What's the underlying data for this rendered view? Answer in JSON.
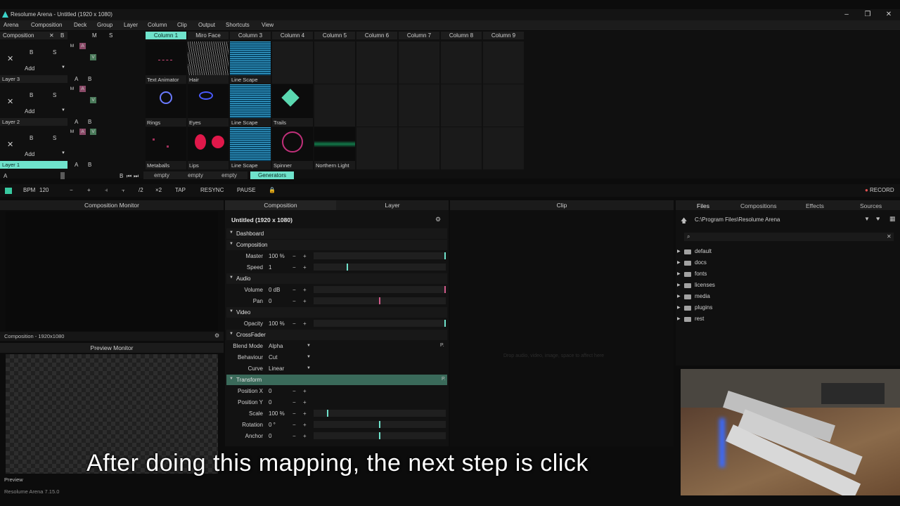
{
  "window": {
    "title": "Resolume Arena - Untitled (1920 x 1080)",
    "minimize": "–",
    "maximize": "❐",
    "close": "✕"
  },
  "menu": [
    "Arena",
    "Composition",
    "Deck",
    "Group",
    "Layer",
    "Column",
    "Clip",
    "Output",
    "Shortcuts",
    "View"
  ],
  "deck": {
    "composition_label": "Composition",
    "comp_buttons": [
      "✕",
      "B",
      "M",
      "S"
    ],
    "columns": [
      "Column 1",
      "Miro Face",
      "Column 3",
      "Column 4",
      "Column 5",
      "Column 6",
      "Column 7",
      "Column 8",
      "Column 9"
    ],
    "layers": [
      {
        "name": "Layer 3",
        "clips": [
          "Text Animator",
          "Hair",
          "Line Scape",
          "",
          "",
          "",
          "",
          "",
          ""
        ]
      },
      {
        "name": "Layer 2",
        "clips": [
          "Rings",
          "Eyes",
          "Line Scape",
          "Trails",
          "",
          "",
          "",
          "",
          ""
        ]
      },
      {
        "name": "Layer 1",
        "clips": [
          "Metaballs",
          "Lips",
          "Line Scape",
          "Spinner",
          "Northern Light",
          "",
          "",
          "",
          ""
        ]
      }
    ],
    "layer_controls": {
      "x": "✕",
      "b": "B",
      "s": "S",
      "add": "Add",
      "m": "M",
      "a": "A",
      "v": "V"
    },
    "bottom_tabs": [
      "empty",
      "empty",
      "empty",
      "Generators"
    ],
    "bottom_left": "A",
    "bottom_b": "B"
  },
  "transport": {
    "bpm_label": "BPM",
    "bpm_value": "120",
    "minus": "−",
    "plus": "+",
    "half": "/2",
    "double": "×2",
    "tap": "TAP",
    "resync": "RESYNC",
    "pause": "PAUSE",
    "record": "RECORD"
  },
  "composition_monitor": {
    "title": "Composition Monitor",
    "footer": "Composition - 1920x1080"
  },
  "preview_monitor": {
    "title": "Preview Monitor",
    "footer": "Preview"
  },
  "params": {
    "tabs": [
      "Composition",
      "Layer"
    ],
    "title": "Untitled (1920 x 1080)",
    "rows": [
      {
        "type": "section",
        "label": "Dashboard"
      },
      {
        "type": "section",
        "label": "Composition"
      },
      {
        "type": "param",
        "label": "Master",
        "value": "100 %",
        "level": 1.0,
        "color": "#6fe3cc"
      },
      {
        "type": "param",
        "label": "Speed",
        "value": "1",
        "level": 0.25,
        "color": "#6fe3cc"
      },
      {
        "type": "section",
        "label": "Audio"
      },
      {
        "type": "param",
        "label": "Volume",
        "value": "0 dB",
        "level": 1.0,
        "color": "#d05a8a"
      },
      {
        "type": "param",
        "label": "Pan",
        "value": "0",
        "level": 0.5,
        "color": "#d05a8a"
      },
      {
        "type": "section",
        "label": "Video"
      },
      {
        "type": "param",
        "label": "Opacity",
        "value": "100 %",
        "level": 1.0,
        "color": "#6fe3cc"
      },
      {
        "type": "section",
        "label": "CrossFader"
      },
      {
        "type": "dropdown",
        "label": "Blend Mode",
        "value": "Alpha"
      },
      {
        "type": "dropdown",
        "label": "Behaviour",
        "value": "Cut"
      },
      {
        "type": "dropdown",
        "label": "Curve",
        "value": "Linear"
      },
      {
        "type": "section",
        "label": "Transform",
        "highlight": true
      },
      {
        "type": "param",
        "label": "Position X",
        "value": "0",
        "level": null
      },
      {
        "type": "param",
        "label": "Position Y",
        "value": "0",
        "level": null
      },
      {
        "type": "param",
        "label": "Scale",
        "value": "100 %",
        "level": 0.1,
        "color": "#6fe3cc"
      },
      {
        "type": "param",
        "label": "Rotation",
        "value": "0 °",
        "level": 0.5,
        "color": "#6fe3cc"
      },
      {
        "type": "param",
        "label": "Anchor",
        "value": "0",
        "level": 0.5,
        "color": "#6fe3cc"
      }
    ]
  },
  "clip_panel": {
    "title": "Clip",
    "placeholder": "Drop audio, video, image, space to affect here"
  },
  "browser": {
    "tabs": [
      "Files",
      "Compositions",
      "Effects",
      "Sources"
    ],
    "path": "C:\\Program Files\\Resolume Arena",
    "search_placeholder": "",
    "folders": [
      "default",
      "docs",
      "fonts",
      "licenses",
      "media",
      "plugins",
      "rest"
    ]
  },
  "caption": "After doing this mapping, the next step is click",
  "status": "Resolume Arena 7.15.0"
}
